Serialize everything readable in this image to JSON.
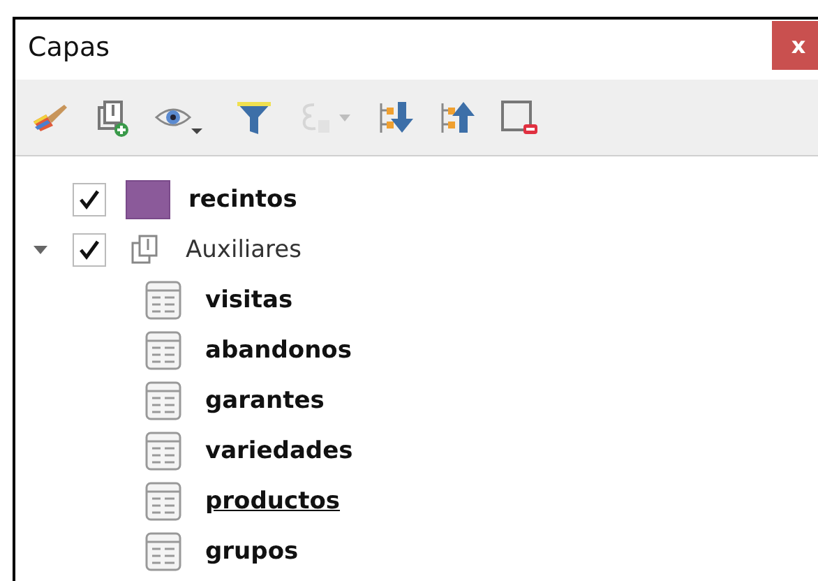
{
  "panel": {
    "title": "Capas",
    "close_label": "x"
  },
  "toolbar": [
    {
      "kind": "style",
      "disabled": false
    },
    {
      "kind": "add-group",
      "disabled": false
    },
    {
      "kind": "visibility",
      "disabled": false,
      "dropdown": true
    },
    {
      "kind": "filter",
      "disabled": false
    },
    {
      "kind": "expression",
      "disabled": true,
      "dropdown": true
    },
    {
      "kind": "expand",
      "disabled": false
    },
    {
      "kind": "collapse",
      "disabled": false
    },
    {
      "kind": "remove",
      "disabled": false
    }
  ],
  "layers": [
    {
      "kind": "vector",
      "name": "recintos",
      "checked": true,
      "color": "#8b5a9a"
    },
    {
      "kind": "group",
      "name": "Auxiliares",
      "checked": true,
      "expanded": true,
      "children": [
        {
          "kind": "table",
          "name": "visitas",
          "underlined": false
        },
        {
          "kind": "table",
          "name": "abandonos",
          "underlined": false
        },
        {
          "kind": "table",
          "name": "garantes",
          "underlined": false
        },
        {
          "kind": "table",
          "name": "variedades",
          "underlined": false
        },
        {
          "kind": "table",
          "name": "productos",
          "underlined": true
        },
        {
          "kind": "table",
          "name": "grupos",
          "underlined": false
        }
      ]
    }
  ]
}
